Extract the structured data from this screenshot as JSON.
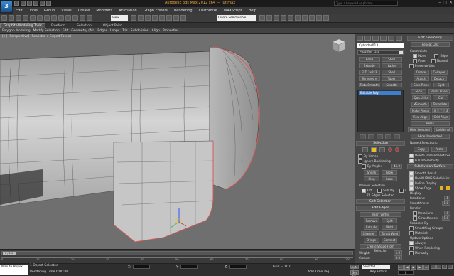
{
  "app": {
    "logo": "3",
    "window_title": "Autodesk 3ds Max 2012 x64",
    "file_name": "Tut.max",
    "search_placeholder": "Type a keyword or phrase"
  },
  "menu": [
    "Edit",
    "Tools",
    "Group",
    "Views",
    "Create",
    "Modifiers",
    "Animation",
    "Graph Editors",
    "Rendering",
    "Customize",
    "MAXScript",
    "Help"
  ],
  "toolbar": {
    "view_dropdown": "View",
    "selection_set": "Create Selection Se"
  },
  "ribbon_tabs": [
    "Graphite Modeling Tools",
    "Freeform",
    "Selection",
    "Object Paint"
  ],
  "ribbon_items": [
    "Polygon Modeling",
    "Modify Selection",
    "Edit",
    "Geometry (All)",
    "Edges",
    "Loops",
    "Tris",
    "Subdivision",
    "Align",
    "Properties"
  ],
  "viewport": {
    "label": "[+] [Perspective] [Realistic + Edged Faces]"
  },
  "command_panel": {
    "object_name": "Cylinder013",
    "modifier_list": "Modifier List",
    "modifier_buttons": [
      "Bend",
      "Shell",
      "Extrude",
      "Lathe",
      "FFD 3x3x3",
      "Shell",
      "Symmetry",
      "Taper",
      "TurboSmooth",
      "Smooth"
    ],
    "stack_item": "Editable Poly",
    "selection": {
      "title": "Selection",
      "by_vertex": "By Vertex",
      "ignore_backfacing": "Ignore Backfacing",
      "by_angle_label": "By Angle:",
      "by_angle_value": "45.0",
      "shrink": "Shrink",
      "grow": "Grow",
      "ring": "Ring",
      "loop": "Loop",
      "preview_label": "Preview Selection",
      "preview_off": "Off",
      "preview_subobj": "SubObj",
      "preview_multi": "Multi",
      "status": "72 Edges Selected"
    },
    "soft_selection": "Soft Selection",
    "edit_edges": {
      "title": "Edit Edges",
      "insert_vertex": "Insert Vertex",
      "remove": "Remove",
      "split": "Split",
      "extrude": "Extrude",
      "weld": "Weld",
      "chamfer": "Chamfer",
      "target_weld": "Target Weld",
      "bridge": "Bridge",
      "connect": "Connect",
      "create_shape": "Create Shape From Selection",
      "weight_label": "Weight:",
      "weight_value": "1.0",
      "crease_label": "Crease:",
      "crease_value": "0.0"
    }
  },
  "edit_geometry": {
    "title": "Edit Geometry",
    "repeat_last": "Repeat Last",
    "constraints_label": "Constraints",
    "none": "None",
    "edge": "Edge",
    "face": "Face",
    "normal": "Normal",
    "preserve_uvs": "Preserve UVs",
    "create": "Create",
    "collapse": "Collapse",
    "attach": "Attach",
    "detach": "Detach",
    "slice_plane": "Slice Plane",
    "split": "Split",
    "slice": "Slice",
    "reset_plane": "Reset Plane",
    "quickslice": "QuickSlice",
    "cut": "Cut",
    "msmooth": "MSmooth",
    "tessellate": "Tessellate",
    "make_planar": "Make Planar",
    "x": "X",
    "y": "Y",
    "z": "Z",
    "view_align": "View Align",
    "grid_align": "Grid Align",
    "relax": "Relax",
    "hide_selected": "Hide Selected",
    "unhide_all": "Unhide All",
    "hide_unselected": "Hide Unselected",
    "named_selections": "Named Selections:",
    "copy": "Copy",
    "paste": "Paste",
    "delete_isolated": "Delete Isolated Vertices",
    "full_interactivity": "Full Interactivity"
  },
  "subdivision_surface": {
    "title": "Subdivision Surface",
    "smooth_result": "Smooth Result",
    "use_nurms": "Use NURMS Subdivision",
    "isoline_display": "Isoline Display",
    "show_cage": "Show Cage......",
    "display_label": "Display",
    "iterations_label": "Iterations:",
    "iterations_value": "1",
    "smoothness_label": "Smoothness:",
    "smoothness_value": "1.0",
    "render_label": "Render",
    "render_iterations_value": "0",
    "render_smoothness_value": "1.0",
    "separate_by": "Separate By",
    "smoothing_groups": "Smoothing Groups",
    "materials": "Materials",
    "update_options": "Update Options",
    "always": "Always",
    "when_rendering": "When Rendering",
    "manually": "Manually"
  },
  "timeline": {
    "slider": "0 / 100",
    "ticks": [
      "0",
      "10",
      "20",
      "30",
      "40",
      "50",
      "60",
      "70",
      "80",
      "90",
      "100"
    ]
  },
  "status": {
    "listener": "Max to Physx",
    "object_count": "1 Object Selected",
    "prompt": "Rendering Time 0:00:00",
    "x_label": "X:",
    "y_label": "Y:",
    "z_label": "Z:",
    "grid": "Grid = 10.0",
    "auto_key": "Auto Key",
    "set_key": "Set Key",
    "selected": "Selected",
    "key_filters": "Key Filters...",
    "add_time_tag": "Add Time Tag",
    "frame": "0"
  },
  "colors": {
    "viewport_bg": "#6f6f6f",
    "panel_bg": "#464646",
    "accent_blue": "#3f7fd0",
    "title_orange": "#e8a040",
    "selection_edge": "#e05858"
  }
}
